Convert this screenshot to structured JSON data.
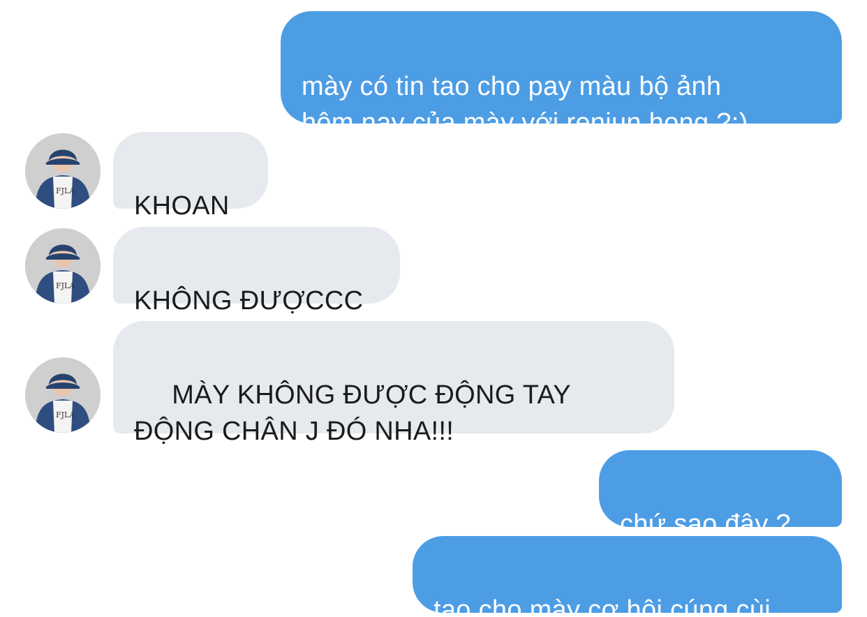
{
  "messages": [
    {
      "id": "m1",
      "side": "outgoing",
      "text": "mày có tin tao cho pay màu bộ ảnh\nhôm nay của mày với renjun hong ?:)"
    },
    {
      "id": "m2",
      "side": "incoming",
      "text": "KHOAN"
    },
    {
      "id": "m3",
      "side": "incoming",
      "text": "KHÔNG ĐƯỢCCC"
    },
    {
      "id": "m4",
      "side": "incoming",
      "text": " MÀY KHÔNG ĐƯỢC ĐỘNG TAY\nĐỘNG CHÂN J ĐÓ NHA!!!"
    },
    {
      "id": "m5",
      "side": "outgoing",
      "text": "chứ sao đây ?"
    },
    {
      "id": "m6",
      "side": "outgoing",
      "text": "tao cho mày cơ hội cúng cùi"
    }
  ],
  "avatar": {
    "shirt_text": "FJLA"
  },
  "colors": {
    "outgoing_bubble": "#4d9de5",
    "incoming_bubble": "#e6e9ee",
    "outgoing_text": "#ffffff",
    "incoming_text": "#1b1b1b",
    "background": "#ffffff"
  }
}
